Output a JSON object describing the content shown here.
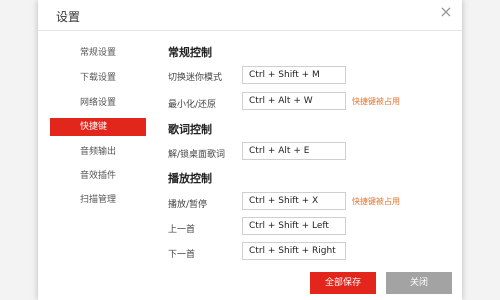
{
  "window": {
    "title": "设置",
    "close_symbol": "×"
  },
  "sidebar": {
    "items": [
      {
        "label": "常规设置",
        "active": false
      },
      {
        "label": "下载设置",
        "active": false
      },
      {
        "label": "网络设置",
        "active": false
      },
      {
        "label": "快捷键",
        "active": true
      },
      {
        "label": "音频输出",
        "active": false
      },
      {
        "label": "音效插件",
        "active": false
      },
      {
        "label": "扫描管理",
        "active": false
      }
    ]
  },
  "sections": {
    "general": {
      "title": "常规控制",
      "rows": [
        {
          "label": "切换迷你模式",
          "hotkey": "Ctrl + Shift + M",
          "warning": ""
        },
        {
          "label": "最小化/还原",
          "hotkey": "Ctrl + Alt + W",
          "warning": "快捷键被占用"
        }
      ]
    },
    "lyrics": {
      "title": "歌词控制",
      "rows": [
        {
          "label": "解/锁桌面歌词",
          "hotkey": "Ctrl + Alt + E",
          "warning": ""
        }
      ]
    },
    "playback": {
      "title": "播放控制",
      "rows": [
        {
          "label": "播放/暂停",
          "hotkey": "Ctrl + Shift + X",
          "warning": "快捷键被占用"
        },
        {
          "label": "上一首",
          "hotkey": "Ctrl + Shift + Left",
          "warning": ""
        },
        {
          "label": "下一首",
          "hotkey": "Ctrl + Shift + Right",
          "warning": ""
        }
      ]
    }
  },
  "footer": {
    "save_label": "全部保存",
    "close_label": "关闭"
  },
  "colors": {
    "accent": "#e2261c",
    "warning": "#e9742b",
    "close_button": "#a3a3a3"
  }
}
